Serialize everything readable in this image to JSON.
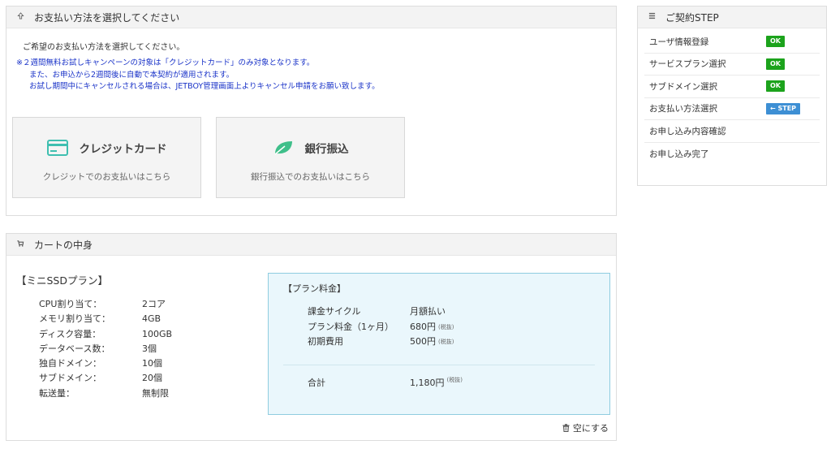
{
  "payment": {
    "title": "お支払い方法を選択してください",
    "intro": "ご希望のお支払い方法を選択してください。",
    "notice": [
      "※２週間無料お試しキャンペーンの対象は「クレジットカード」のみ対象となります。",
      "また、お申込から2週間後に自動で本契約が適用されます。",
      "お試し期間中にキャンセルされる場合は、JETBOY管理画面上よりキャンセル申請をお願い致します。"
    ],
    "methods": [
      {
        "title": "クレジットカード",
        "subtitle": "クレジットでのお支払いはこちら",
        "icon": "credit-card-icon"
      },
      {
        "title": "銀行振込",
        "subtitle": "銀行振込でのお支払いはこちら",
        "icon": "leaf-icon"
      }
    ]
  },
  "steps": {
    "title": "ご契約STEP",
    "items": [
      {
        "label": "ユーザ情報登録",
        "badge": "OK"
      },
      {
        "label": "サービスプラン選択",
        "badge": "OK"
      },
      {
        "label": "サブドメイン選択",
        "badge": "OK"
      },
      {
        "label": "お支払い方法選択",
        "badge": "← STEP"
      },
      {
        "label": "お申し込み内容確認",
        "badge": ""
      },
      {
        "label": "お申し込み完了",
        "badge": ""
      }
    ]
  },
  "cart": {
    "title": "カートの中身",
    "plan_name": "【ミニSSDプラン】",
    "specs": [
      {
        "key": "CPU割り当て：",
        "value": "2コア"
      },
      {
        "key": "メモリ割り当て：",
        "value": "4GB"
      },
      {
        "key": "ディスク容量：",
        "value": "100GB"
      },
      {
        "key": "データベース数：",
        "value": "3個"
      },
      {
        "key": "独自ドメイン：",
        "value": "10個"
      },
      {
        "key": "サブドメイン：",
        "value": "20個"
      },
      {
        "key": "転送量：",
        "value": "無制限"
      }
    ],
    "price_title": "【プラン料金】",
    "tax_label": "(税抜)",
    "prices": [
      {
        "key": "課金サイクル",
        "value": "月額払い"
      },
      {
        "key": "プラン料金（1ヶ月）",
        "value": "680円"
      },
      {
        "key": "初期費用",
        "value": "500円"
      }
    ],
    "total_label": "合計",
    "total_value": "1,180円",
    "empty_label": "空にする"
  },
  "colors": {
    "ok": "#1ca31c",
    "current_step": "#3d8fd4",
    "notice_text": "#1a33c8",
    "price_box": "#eaf7fc"
  }
}
